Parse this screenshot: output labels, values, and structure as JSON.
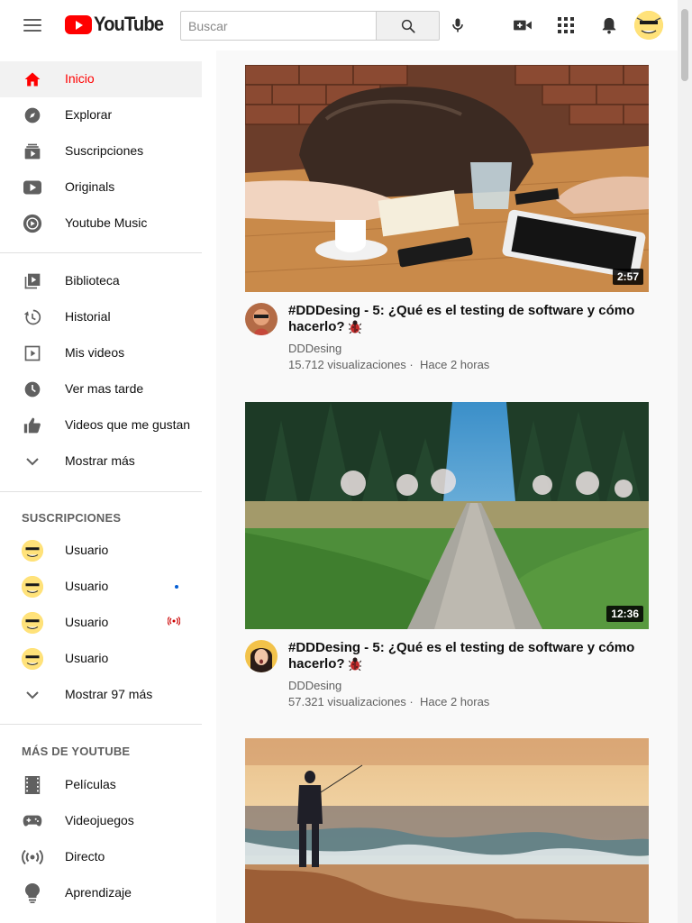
{
  "header": {
    "logo_text": "YouTube",
    "search_placeholder": "Buscar"
  },
  "sidebar": {
    "primary": [
      {
        "label": "Inicio",
        "icon": "home-icon",
        "active": true
      },
      {
        "label": "Explorar",
        "icon": "compass-icon"
      },
      {
        "label": "Suscripciones",
        "icon": "subscriptions-icon"
      },
      {
        "label": "Originals",
        "icon": "originals-icon"
      },
      {
        "label": "Youtube Music",
        "icon": "music-icon"
      }
    ],
    "library": [
      {
        "label": "Biblioteca",
        "icon": "library-icon"
      },
      {
        "label": "Historial",
        "icon": "history-icon"
      },
      {
        "label": "Mis videos",
        "icon": "my-videos-icon"
      },
      {
        "label": "Ver mas tarde",
        "icon": "watch-later-icon"
      },
      {
        "label": "Videos que me gustan",
        "icon": "thumbs-up-icon"
      },
      {
        "label": "Mostrar más",
        "icon": "chevron-down-icon"
      }
    ],
    "subscriptions_header": "SUSCRIPCIONES",
    "subscriptions": [
      {
        "label": "Usuario",
        "badge": ""
      },
      {
        "label": "Usuario",
        "badge": "new"
      },
      {
        "label": "Usuario",
        "badge": "live"
      },
      {
        "label": "Usuario",
        "badge": ""
      }
    ],
    "show_more_subs": "Mostrar 97 más",
    "more_header": "MÁS DE YOUTUBE",
    "more": [
      {
        "label": "Películas",
        "icon": "film-icon"
      },
      {
        "label": "Videojuegos",
        "icon": "gamepad-icon"
      },
      {
        "label": "Directo",
        "icon": "live-icon"
      },
      {
        "label": "Aprendizaje",
        "icon": "lightbulb-icon"
      }
    ]
  },
  "videos": [
    {
      "title": "#DDDesing - 5: ¿Qué es el testing de software y cómo hacerlo?",
      "channel": "DDDesing",
      "views": "15.712 visualizaciones",
      "age": "Hace 2 horas",
      "duration": "2:57"
    },
    {
      "title": "#DDDesing - 5: ¿Qué es el testing de software y cómo hacerlo?",
      "channel": "DDDesing",
      "views": "57.321 visualizaciones",
      "age": "Hace 2 horas",
      "duration": "12:36"
    },
    {
      "title": "",
      "channel": "",
      "views": "",
      "age": "",
      "duration": ""
    }
  ],
  "colors": {
    "brand_red": "#ff0000",
    "text_secondary": "#606060"
  }
}
